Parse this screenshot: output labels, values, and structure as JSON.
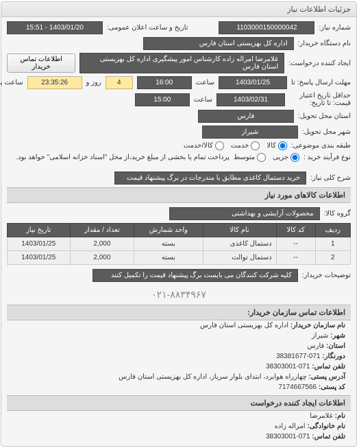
{
  "header": {
    "title": "جزئیات اطلاعات نیاز"
  },
  "main": {
    "req_no_label": "شماره نیاز:",
    "req_no": "1103000150000042",
    "announce_label": "تاریخ و ساعت اعلان عمومی:",
    "announce": "1403/01/20 - 15:51",
    "org_label": "نام دستگاه خریدار:",
    "org": "اداره کل بهزیستی استان فارس",
    "requester_label": "ایجاد کننده درخواست:",
    "requester": "غلامرضا امراله زاده کارشناس امور پیشگیری اداره کل بهزیستی استان فارس",
    "contact_btn": "اطلاعات تماس خریدار",
    "deadline_reply_label": "مهلت ارسال پاسخ: تا",
    "deadline_reply_date": "1403/01/25",
    "time_label": "ساعت",
    "deadline_reply_time": "16:00",
    "days": "4",
    "days_label": "روز و",
    "countdown": "23:35:26",
    "remain_label": "ساعت باقی مانده",
    "validity_label": "حداقل تاریخ اعتبار قیمت: تا تاریخ:",
    "validity_date": "1403/02/31",
    "validity_time": "15:00",
    "province_label": "استان محل تحویل:",
    "province": "فارس",
    "city_label": "شهر محل تحویل:",
    "city": "شیراز",
    "subject_type_label": "طبقه بندی موضوعی:",
    "r_goods": "کالا",
    "r_service": "خدمت",
    "r_both": "کالا/خدمت",
    "buy_type_label": "نوع فرآیند خرید :",
    "r_minor": "جزیی",
    "r_mid": "متوسط",
    "buy_note": "پرداخت تمام یا بخشی از مبلغ خرید،از محل \"اسناد خزانه اسلامی\" خواهد بود.",
    "desc_label": "شرح کلی نیاز:",
    "desc": "خرید دستمال کاغذی مطابق با مندرجات در برگ پیشنهاد قیمت",
    "items_title": "اطلاعات کالاهای مورد نیاز",
    "group_label": "گروه کالا:",
    "group": "محصولات آرایشی و بهداشتی",
    "note_label": "توضیحات خریدار:",
    "note": "کلیه شرکت کنندگان می بایست برگ پیشنهاد قیمت را تکمیل کنند"
  },
  "table": {
    "headers": [
      "ردیف",
      "کد کالا",
      "نام کالا",
      "واحد شمارش",
      "تعداد / مقدار",
      "تاریخ نیاز"
    ],
    "rows": [
      {
        "idx": "1",
        "code": "--",
        "name": "دستمال کاغذی",
        "unit": "بسته",
        "qty": "2,000",
        "date": "1403/01/25"
      },
      {
        "idx": "2",
        "code": "--",
        "name": "دستمال توالت",
        "unit": "بسته",
        "qty": "2,000",
        "date": "1403/01/25"
      }
    ]
  },
  "footer_phone": "۰۲۱-۸۸۳۴۹۶۷",
  "contact": {
    "title": "اطلاعات تماس سازمان خریدار:",
    "org_label": "نام سازمان خریدار:",
    "org": "اداره کل بهزیستی استان فارس",
    "city_label": "شهر:",
    "city": "شیراز",
    "province_label": "استان:",
    "province": "فارس",
    "fax_label": "دورنگار:",
    "fax": "071-38381677",
    "phone_label": "تلفن تماس:",
    "phone": "071-38303001",
    "postal_label": "آدرس پستی:",
    "postal": "چهارراه هوابرد، ابتدای بلوار سرباز، اداره کل بهزیستی استان فارس",
    "zip_label": "کد پستی:",
    "zip": "7174667566",
    "creator_title": "اطلاعات ایجاد کننده درخواست",
    "fname_label": "نام:",
    "fname": "غلامرضا",
    "lname_label": "نام خانوادگی:",
    "lname": "امراله زاده",
    "cphone_label": "تلفن تماس:",
    "cphone": "071-38303001"
  }
}
